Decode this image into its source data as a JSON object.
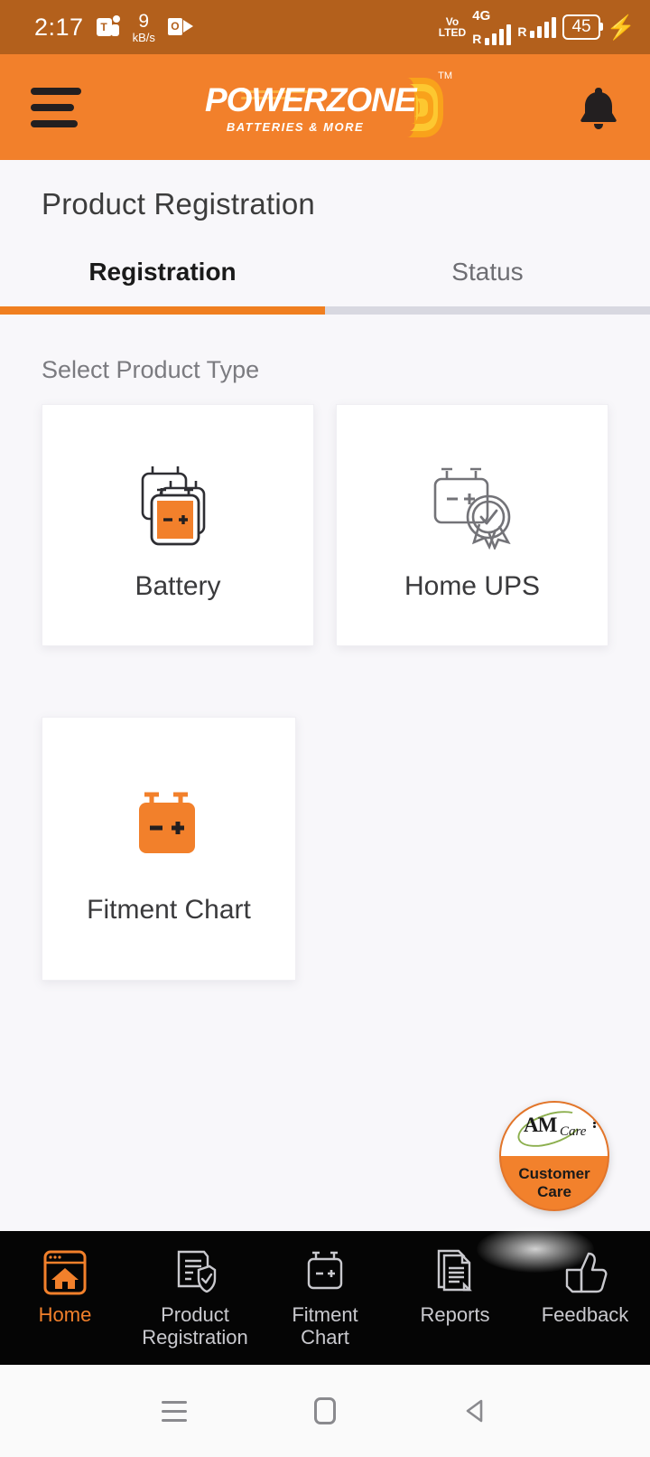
{
  "statusbar": {
    "time": "2:17",
    "network_speed_value": "9",
    "network_speed_unit": "kB/s",
    "volte_line1": "Vo",
    "volte_line2": "LTED",
    "network_type": "4G",
    "roaming_label_1": "R",
    "roaming_label_2": "R",
    "battery_level": "45",
    "charging": true,
    "icons": [
      "microsoft-teams-icon",
      "outlook-icon",
      "volte-icon",
      "signal-bars-icon",
      "battery-icon",
      "charging-bolt-icon"
    ],
    "background_color": "#B3601C"
  },
  "header": {
    "menu_icon": "hamburger-menu-icon",
    "brand_name": "POWERZONE",
    "brand_name_part1": "POWER",
    "brand_name_part2": "ZONE",
    "brand_tagline": "BATTERIES & MORE",
    "trademark": "TM",
    "notification_icon": "bell-icon",
    "background_color": "#F2802B"
  },
  "page": {
    "title": "Product Registration"
  },
  "tabs": [
    {
      "label": "Registration",
      "active": true
    },
    {
      "label": "Status",
      "active": false
    }
  ],
  "main": {
    "section_label": "Select Product Type",
    "product_types": [
      {
        "label": "Battery",
        "icon": "stacked-batteries-icon"
      },
      {
        "label": "Home UPS",
        "icon": "battery-certificate-icon"
      },
      {
        "label": "Fitment Chart",
        "icon": "orange-battery-icon"
      }
    ]
  },
  "fab": {
    "logo_am": "AM",
    "logo_care": "Care",
    "label_line1": "Customer",
    "label_line2": "Care",
    "icon": "customer-care-icon",
    "color": "#F2812C"
  },
  "bottom_nav": [
    {
      "label": "Home",
      "label_line1": "Home",
      "label_line2": "",
      "icon": "home-icon",
      "active": true
    },
    {
      "label": "Product Registration",
      "label_line1": "Product",
      "label_line2": "Registration",
      "icon": "document-shield-icon",
      "active": false
    },
    {
      "label": "Fitment Chart",
      "label_line1": "Fitment",
      "label_line2": "Chart",
      "icon": "battery-outline-icon",
      "active": false
    },
    {
      "label": "Reports",
      "label_line1": "Reports",
      "label_line2": "",
      "icon": "reports-icon",
      "active": false
    },
    {
      "label": "Feedback",
      "label_line1": "Feedback",
      "label_line2": "",
      "icon": "thumbs-up-icon",
      "active": false
    }
  ],
  "android_nav": {
    "recent_icon": "recent-apps-icon",
    "home_icon": "android-home-icon",
    "back_icon": "android-back-icon"
  },
  "colors": {
    "brand_orange": "#F2802B",
    "status_bar": "#B3601C",
    "accent_underline": "#F07F20",
    "page_background": "#F8F7FA",
    "nav_background": "#050505",
    "logo_yellow": "#FBB040"
  }
}
